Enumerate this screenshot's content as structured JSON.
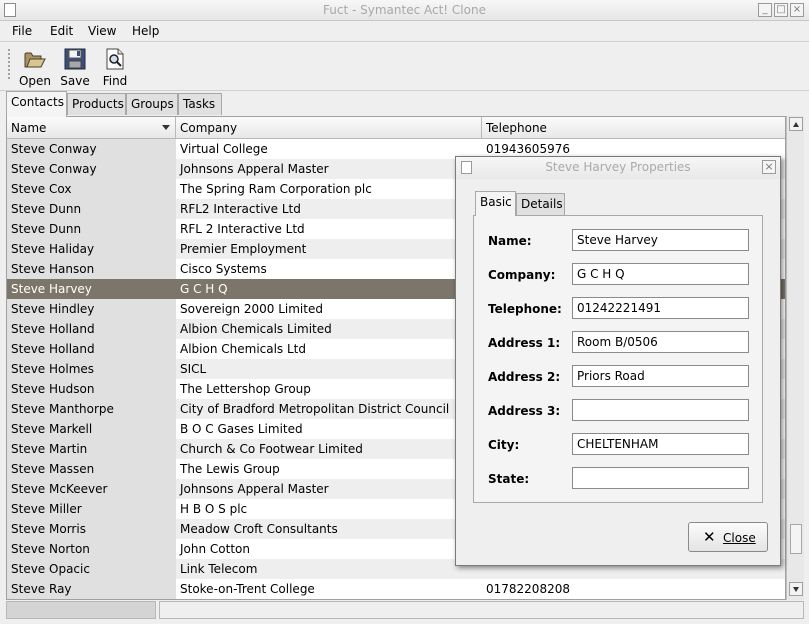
{
  "window": {
    "title": "Fuct - Symantec Act! Clone"
  },
  "menu": [
    {
      "label": "File"
    },
    {
      "label": "Edit"
    },
    {
      "label": "View"
    },
    {
      "label": "Help"
    }
  ],
  "toolbar": {
    "open_label": "Open",
    "save_label": "Save",
    "find_label": "Find"
  },
  "tabs": [
    {
      "label": "Contacts"
    },
    {
      "label": "Products"
    },
    {
      "label": "Groups"
    },
    {
      "label": "Tasks"
    }
  ],
  "table": {
    "columns": [
      "Name",
      "Company",
      "Telephone"
    ],
    "rows": [
      {
        "name": "Steve Conway",
        "company": "Virtual College",
        "phone": "01943605976"
      },
      {
        "name": "Steve Conway",
        "company": "Johnsons Apperal Master",
        "phone": ""
      },
      {
        "name": "Steve Cox",
        "company": "The Spring Ram Corporation plc",
        "phone": ""
      },
      {
        "name": "Steve Dunn",
        "company": "RFL2 Interactive Ltd",
        "phone": ""
      },
      {
        "name": "Steve Dunn",
        "company": "RFL 2 Interactive Ltd",
        "phone": ""
      },
      {
        "name": "Steve Haliday",
        "company": "Premier Employment",
        "phone": ""
      },
      {
        "name": "Steve Hanson",
        "company": "Cisco Systems",
        "phone": ""
      },
      {
        "name": "Steve Harvey",
        "company": "G C H Q",
        "phone": ""
      },
      {
        "name": "Steve Hindley",
        "company": "Sovereign 2000 Limited",
        "phone": ""
      },
      {
        "name": "Steve Holland",
        "company": "Albion Chemicals Limited",
        "phone": ""
      },
      {
        "name": "Steve Holland",
        "company": "Albion Chemicals Ltd",
        "phone": ""
      },
      {
        "name": "Steve Holmes",
        "company": "SICL",
        "phone": ""
      },
      {
        "name": "Steve Hudson",
        "company": "The Lettershop Group",
        "phone": ""
      },
      {
        "name": "Steve Manthorpe",
        "company": "City of Bradford Metropolitan District Council",
        "phone": ""
      },
      {
        "name": "Steve Markell",
        "company": "B O C Gases Limited",
        "phone": ""
      },
      {
        "name": "Steve Martin",
        "company": "Church & Co Footwear Limited",
        "phone": ""
      },
      {
        "name": "Steve Massen",
        "company": "The Lewis Group",
        "phone": ""
      },
      {
        "name": "Steve McKeever",
        "company": "Johnsons Apperal Master",
        "phone": ""
      },
      {
        "name": "Steve Miller",
        "company": "H B O S plc",
        "phone": ""
      },
      {
        "name": "Steve Morris",
        "company": "Meadow Croft Consultants",
        "phone": ""
      },
      {
        "name": "Steve Norton",
        "company": "John Cotton",
        "phone": ""
      },
      {
        "name": "Steve Opacic",
        "company": "Link Telecom",
        "phone": ""
      },
      {
        "name": "Steve Ray",
        "company": "Stoke-on-Trent College",
        "phone": "01782208208"
      }
    ],
    "selected_index": 7
  },
  "dialog": {
    "title": "Steve Harvey Properties",
    "tabs": [
      "Basic",
      "Details"
    ],
    "fields": [
      {
        "label": "Name:",
        "value": "Steve Harvey"
      },
      {
        "label": "Company:",
        "value": "G C H Q"
      },
      {
        "label": "Telephone:",
        "value": "01242221491"
      },
      {
        "label": "Address 1:",
        "value": "Room B/0506"
      },
      {
        "label": "Address 2:",
        "value": "Priors Road"
      },
      {
        "label": "Address 3:",
        "value": ""
      },
      {
        "label": "City:",
        "value": "CHELTENHAM"
      },
      {
        "label": "State:",
        "value": ""
      }
    ],
    "close_label": "Close"
  },
  "colors": {
    "selection": "#7c7569",
    "window_bg": "#efefef"
  }
}
